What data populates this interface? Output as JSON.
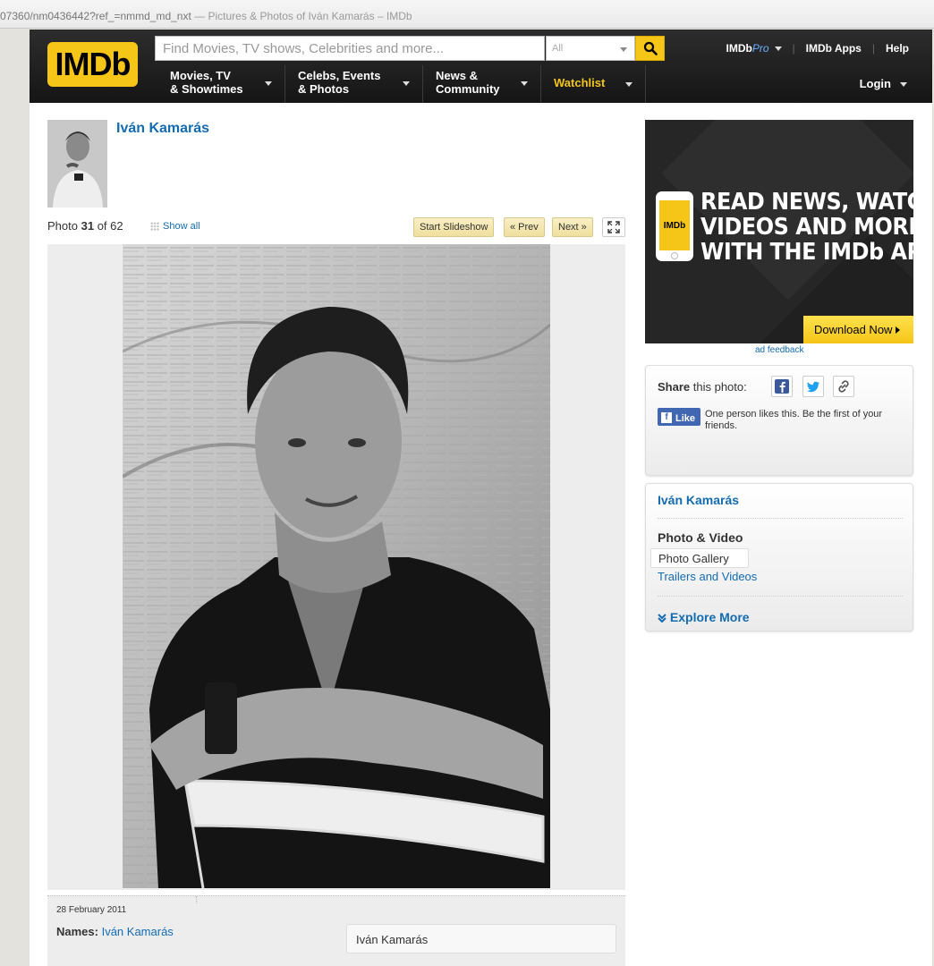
{
  "browser": {
    "url": "07360/nm0436442?ref_=nmmd_md_nxt",
    "separator": " — ",
    "page_title": "Pictures & Photos of Iván Kamarás – IMDb"
  },
  "header": {
    "logo_text": "IMDb",
    "search_placeholder": "Find Movies, TV shows, Celebrities and more...",
    "search_category": "All",
    "pro_prefix": "IMDb",
    "pro_suffix": "Pro",
    "apps_label": "IMDb Apps",
    "help_label": "Help",
    "login_label": "Login",
    "menu": [
      {
        "line1": "Movies, TV",
        "line2": "& Showtimes"
      },
      {
        "line1": "Celebs, Events",
        "line2": "& Photos"
      },
      {
        "line1": "News &",
        "line2": "Community"
      }
    ],
    "watchlist_label": "Watchlist"
  },
  "person": {
    "name": "Iván Kamarás"
  },
  "gallery": {
    "photo_prefix": "Photo",
    "current": "31",
    "of_label": "of",
    "total": "62",
    "show_all": "Show all",
    "slideshow": "Start Slideshow",
    "prev": "« Prev",
    "next": "Next »"
  },
  "caption": {
    "date": "28 February 2011",
    "names_label": "Names:",
    "names_value": "Iván Kamarás",
    "tag_box": "Iván Kamarás"
  },
  "ad": {
    "phone_logo": "IMDb",
    "headline_1": "READ NEWS, WATCH",
    "headline_2": "VIDEOS AND MORE",
    "headline_3": "WITH THE IMDb APP",
    "download": "Download Now",
    "feedback": "ad feedback"
  },
  "share": {
    "label_bold": "Share",
    "label_rest": " this photo:",
    "like_label": "Like",
    "like_text": "One person likes this. Be the first of your friends."
  },
  "sidebar_nav": {
    "name": "Iván Kamarás",
    "section_head": "Photo & Video",
    "gallery": "Photo Gallery",
    "trailers": "Trailers and Videos",
    "explore": "Explore More"
  },
  "colors": {
    "imdb_yellow": "#f5c518",
    "link_blue": "#136cb2"
  }
}
